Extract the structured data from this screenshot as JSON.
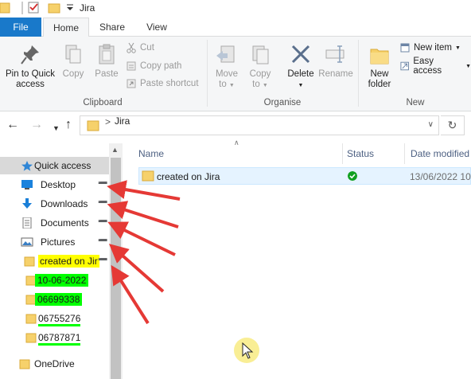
{
  "window": {
    "title": "Jira"
  },
  "tabs": {
    "file": "File",
    "home": "Home",
    "share": "Share",
    "view": "View"
  },
  "ribbon": {
    "clipboard": {
      "label": "Clipboard",
      "pin_line1": "Pin to Quick",
      "pin_line2": "access",
      "copy": "Copy",
      "paste": "Paste",
      "cut": "Cut",
      "copy_path": "Copy path",
      "paste_shortcut": "Paste shortcut"
    },
    "organise": {
      "label": "Organise",
      "move_to_1": "Move",
      "move_to_2": "to",
      "copy_to_1": "Copy",
      "copy_to_2": "to",
      "delete": "Delete",
      "rename": "Rename"
    },
    "new": {
      "label": "New",
      "new_folder_1": "New",
      "new_folder_2": "folder",
      "new_item": "New item",
      "easy_access": "Easy access"
    }
  },
  "address": {
    "path": "Jira",
    "separator": ">"
  },
  "nav": {
    "quick_access": "Quick access",
    "items": [
      {
        "label": "Desktop"
      },
      {
        "label": "Downloads"
      },
      {
        "label": "Documents"
      },
      {
        "label": "Pictures"
      },
      {
        "label": "created on Jir"
      },
      {
        "label": "10-06-2022"
      },
      {
        "label": "06699338"
      },
      {
        "label": "06755276"
      },
      {
        "label": "06787871"
      },
      {
        "label": "OneDrive"
      }
    ]
  },
  "columns": {
    "name": "Name",
    "status": "Status",
    "date": "Date modified"
  },
  "files": [
    {
      "name": "created on Jira",
      "date": "13/06/2022 10:"
    }
  ],
  "colors": {
    "accent": "#1979ca",
    "folder": "#f6d16b",
    "highlight_yellow": "#ffff00",
    "highlight_green": "#00ff00",
    "arrow": "#e53935"
  }
}
